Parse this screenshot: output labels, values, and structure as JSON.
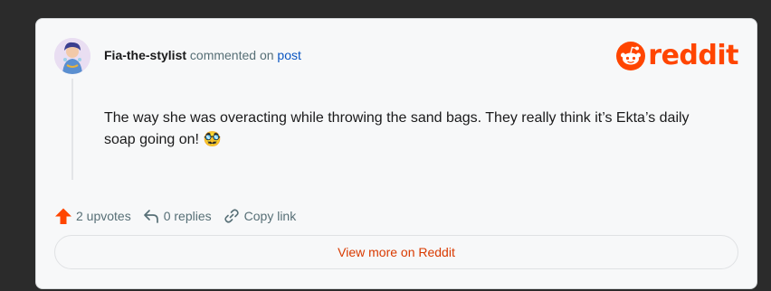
{
  "comment": {
    "author": "Fia-the-stylist",
    "action_text": "commented on",
    "post_link": "post",
    "body": "The way she was overacting while throwing the sand bags. They really think it’s Ekta’s daily soap going on!",
    "emoji": "🥸"
  },
  "logo": {
    "wordmark": "reddit",
    "icon": "reddit-snoo-icon"
  },
  "actions": {
    "upvotes_label": "2 upvotes",
    "replies_label": "0 replies",
    "copy_label": "Copy link"
  },
  "footer": {
    "view_more_label": "View more on Reddit"
  },
  "colors": {
    "brand": "#ff4500",
    "link": "#0a56c2",
    "view_more": "#d93a00",
    "upvote": "#ff4500"
  }
}
